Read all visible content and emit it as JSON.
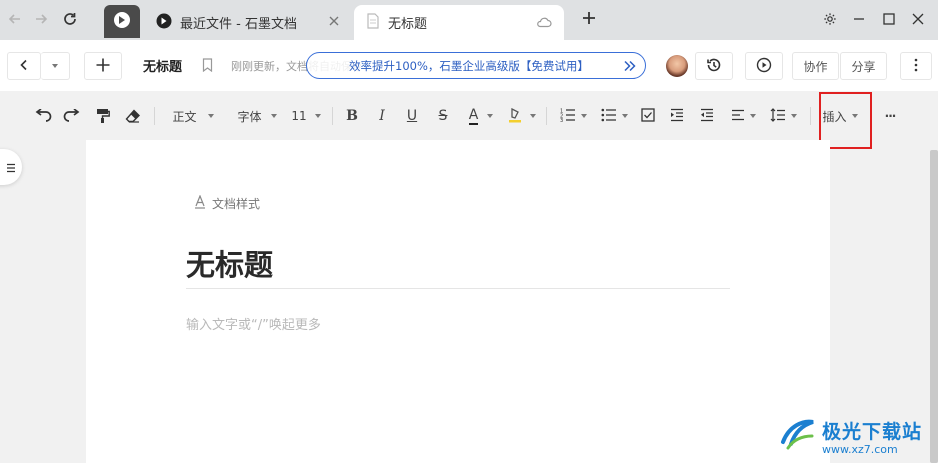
{
  "tabs": [
    {
      "title": "最近文件 - 石墨文档"
    },
    {
      "title": "无标题"
    }
  ],
  "header": {
    "doc_title": "无标题",
    "update_status": "刚刚更新，文档将自动保存",
    "promo_text": "效率提升100%，石墨企业高级版【免费试用】",
    "collaborate_label": "协作",
    "share_label": "分享"
  },
  "toolbar": {
    "paragraph_style": "正文",
    "font": "字体",
    "font_size": "11",
    "insert_label": "插入",
    "bold": "B",
    "italic": "I",
    "underline": "U",
    "strike": "S",
    "font_color": "A",
    "more": "···"
  },
  "document": {
    "style_label": "文档样式",
    "heading": "无标题",
    "placeholder": "输入文字或“/”唤起更多"
  },
  "watermark": {
    "name": "极光下载站",
    "url": "www.xz7.com"
  },
  "colors": {
    "promo_blue": "#3a6fd8",
    "highlight_red": "#e02020",
    "watermark_blue": "#1b7fd0"
  },
  "icons": [
    "back-icon",
    "forward-icon",
    "reload-icon",
    "shimo-logo-icon",
    "document-icon",
    "close-icon",
    "cloud-icon",
    "plus-icon",
    "gear-icon",
    "minimize-icon",
    "maximize-icon",
    "window-close-icon",
    "chevron-left-icon",
    "chevron-down-icon",
    "bookmark-icon",
    "double-chevron-right-icon",
    "history-icon",
    "play-icon",
    "more-vertical-icon",
    "undo-icon",
    "redo-icon",
    "format-painter-icon",
    "eraser-icon",
    "highlight-icon",
    "ordered-list-icon",
    "bullet-list-icon",
    "checkbox-icon",
    "indent-icon",
    "outdent-icon",
    "align-icon",
    "line-height-icon",
    "outline-menu-icon",
    "text-style-icon"
  ]
}
